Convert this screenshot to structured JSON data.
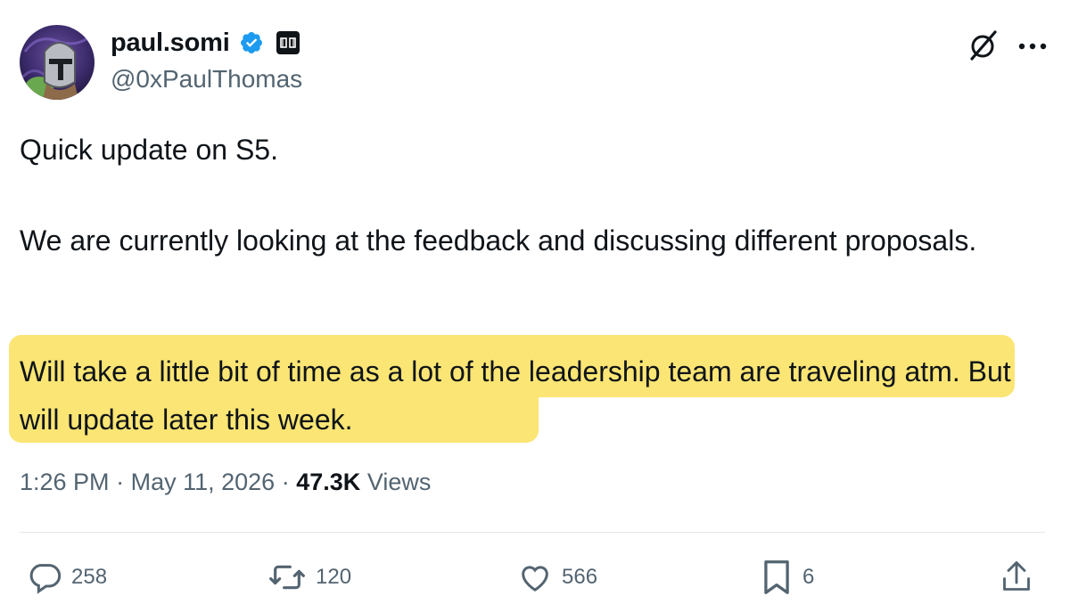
{
  "author": {
    "display_name": "paul.somi",
    "handle": "@0xPaulThomas",
    "verified": true,
    "avatar_icon": "knight-helmet-avatar",
    "affiliate_badge_icon": "affiliate-logo-icon"
  },
  "header_actions": {
    "grok_icon": "grok-icon",
    "more_icon": "more-dots-icon"
  },
  "tweet": {
    "paragraphs": [
      "Quick update on S5.",
      "We are currently looking at the feedback and discussing different proposals.",
      "Will take a little bit of time as a lot of the leadership team are traveling atm. But will update later this week."
    ],
    "highlight_color": "#fbe574"
  },
  "meta": {
    "time": "1:26 PM",
    "separator": "·",
    "date": "May 11, 2026",
    "views_count": "47.3K",
    "views_label": "Views"
  },
  "actions": {
    "replies": {
      "icon": "reply-icon",
      "count": "258"
    },
    "reposts": {
      "icon": "repost-icon",
      "count": "120"
    },
    "likes": {
      "icon": "heart-icon",
      "count": "566"
    },
    "bookmarks": {
      "icon": "bookmark-icon",
      "count": "6"
    },
    "share": {
      "icon": "share-icon"
    }
  },
  "colors": {
    "text_primary": "#0f1419",
    "text_secondary": "#536471",
    "verified_blue": "#1d9bf0"
  }
}
